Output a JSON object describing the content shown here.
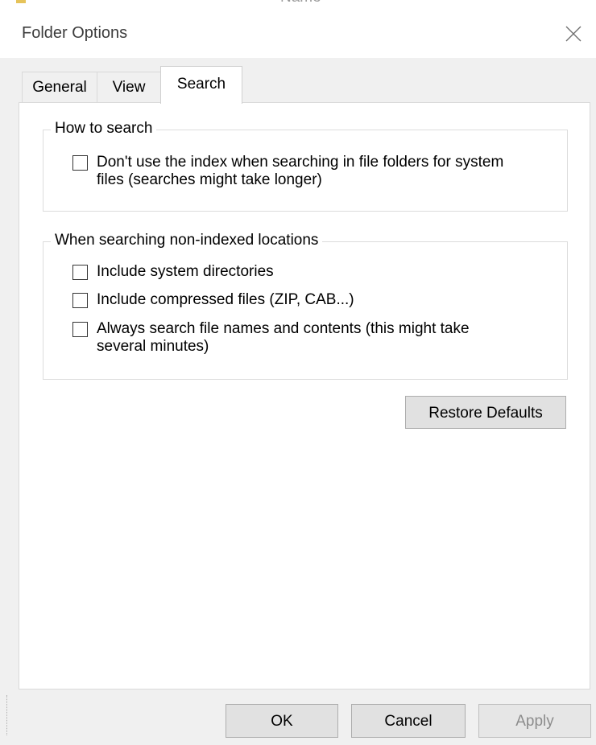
{
  "background_window": {
    "partial_text": "Name"
  },
  "window": {
    "title": "Folder Options",
    "close_icon": "close-icon"
  },
  "tabs": [
    {
      "label": "General",
      "active": false
    },
    {
      "label": "View",
      "active": false
    },
    {
      "label": "Search",
      "active": true
    }
  ],
  "how_to_search": {
    "legend": "How to search",
    "options": [
      {
        "line1": "Don't use the index when searching in file folders for system",
        "line2": "files (searches might take longer)",
        "checked": false
      }
    ]
  },
  "non_indexed": {
    "legend": "When searching non-indexed locations",
    "options": [
      {
        "line1": "Include system directories",
        "checked": false
      },
      {
        "line1": "Include compressed files (ZIP, CAB...)",
        "checked": false
      },
      {
        "line1": "Always search file names and contents (this might take",
        "line2": "several minutes)",
        "checked": false
      }
    ]
  },
  "buttons": {
    "restore_defaults": "Restore Defaults",
    "ok": "OK",
    "cancel": "Cancel",
    "apply": "Apply",
    "apply_enabled": false
  }
}
